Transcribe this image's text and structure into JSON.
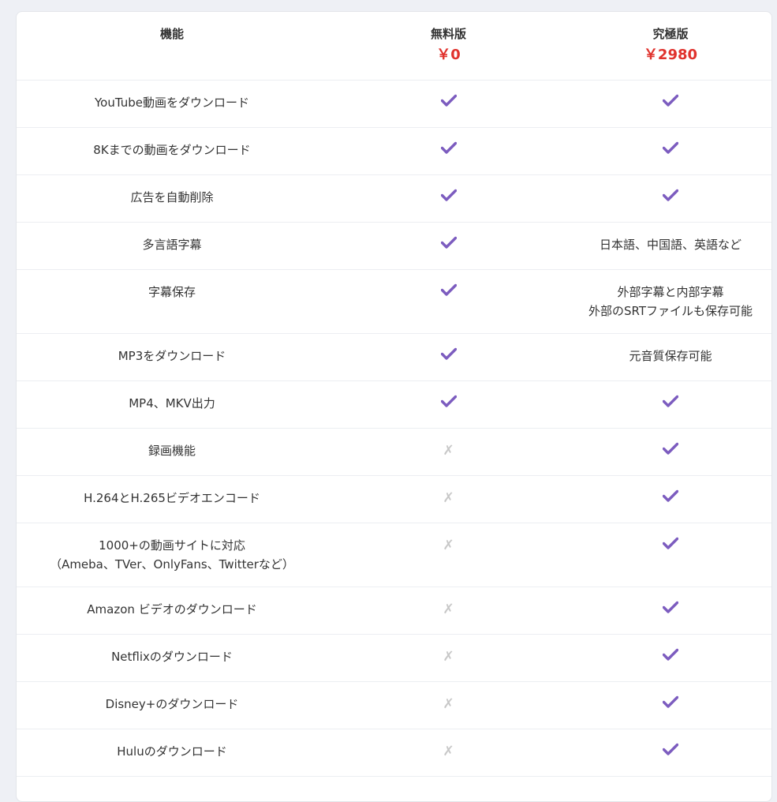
{
  "header": {
    "feature_label": "機能",
    "free": {
      "label": "無料版",
      "price": "￥0"
    },
    "ultimate": {
      "label": "究極版",
      "price": "￥2980"
    }
  },
  "colors": {
    "check": "#7c5cbf",
    "cross": "#c8c8c8",
    "price": "#e0322d"
  },
  "rows": [
    {
      "feature": [
        "YouTube動画をダウンロード"
      ],
      "free": "check",
      "ultimate": "check",
      "ultimate_text": []
    },
    {
      "feature": [
        "8Kまでの動画をダウンロード"
      ],
      "free": "check",
      "ultimate": "check",
      "ultimate_text": []
    },
    {
      "feature": [
        "広告を自動削除"
      ],
      "free": "check",
      "ultimate": "check",
      "ultimate_text": []
    },
    {
      "feature": [
        "多言語字幕"
      ],
      "free": "check",
      "ultimate": "text",
      "ultimate_text": [
        "日本語、中国語、英語など"
      ]
    },
    {
      "feature": [
        "字幕保存"
      ],
      "free": "check",
      "ultimate": "text",
      "ultimate_text": [
        "外部字幕と内部字幕",
        "外部のSRTファイルも保存可能"
      ]
    },
    {
      "feature": [
        "MP3をダウンロード"
      ],
      "free": "check",
      "ultimate": "text",
      "ultimate_text": [
        "元音質保存可能"
      ]
    },
    {
      "feature": [
        "MP4、MKV出力"
      ],
      "free": "check",
      "ultimate": "check",
      "ultimate_text": []
    },
    {
      "feature": [
        "録画機能"
      ],
      "free": "cross",
      "ultimate": "check",
      "ultimate_text": []
    },
    {
      "feature": [
        "H.264とH.265ビデオエンコード"
      ],
      "free": "cross",
      "ultimate": "check",
      "ultimate_text": []
    },
    {
      "feature": [
        "1000+の動画サイトに対応",
        "（Ameba、TVer、OnlyFans、Twitterなど）"
      ],
      "free": "cross",
      "ultimate": "check",
      "ultimate_text": []
    },
    {
      "feature": [
        "Amazon ビデオのダウンロード"
      ],
      "free": "cross",
      "ultimate": "check",
      "ultimate_text": []
    },
    {
      "feature": [
        "Netflixのダウンロード"
      ],
      "free": "cross",
      "ultimate": "check",
      "ultimate_text": []
    },
    {
      "feature": [
        "Disney+のダウンロード"
      ],
      "free": "cross",
      "ultimate": "check",
      "ultimate_text": []
    },
    {
      "feature": [
        "Huluのダウンロード"
      ],
      "free": "cross",
      "ultimate": "check",
      "ultimate_text": []
    }
  ],
  "icons": {
    "check": "check-icon",
    "cross": "cross-icon"
  },
  "cross_glyph": "✗"
}
